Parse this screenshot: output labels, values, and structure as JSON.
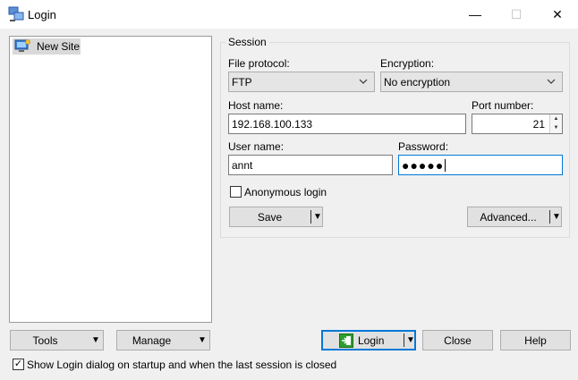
{
  "window": {
    "title": "Login",
    "minimize_glyph": "—",
    "maximize_glyph": "☐",
    "close_glyph": "✕"
  },
  "sites": [
    {
      "label": "New Site",
      "icon": "computer-icon"
    }
  ],
  "session": {
    "caption": "Session",
    "file_protocol_label": "File protocol:",
    "file_protocol_value": "FTP",
    "encryption_label": "Encryption:",
    "encryption_value": "No encryption",
    "host_label": "Host name:",
    "host_value": "192.168.100.133",
    "port_label": "Port number:",
    "port_value": "21",
    "user_label": "User name:",
    "user_value": "annt",
    "password_label": "Password:",
    "password_mask": "●●●●●",
    "anonymous_label": "Anonymous login",
    "anonymous_checked": false,
    "save_label": "Save",
    "advanced_label": "Advanced..."
  },
  "bottom": {
    "tools_label": "Tools",
    "manage_label": "Manage",
    "login_label": "Login",
    "close_label": "Close",
    "help_label": "Help",
    "startup_label": "Show Login dialog on startup and when the last session is closed",
    "startup_checked": true,
    "checkmark_glyph": "✓"
  },
  "colors": {
    "accent": "#0078d7",
    "window_bg": "#f0f0f0",
    "login_icon_green": "#2e9e2e"
  }
}
